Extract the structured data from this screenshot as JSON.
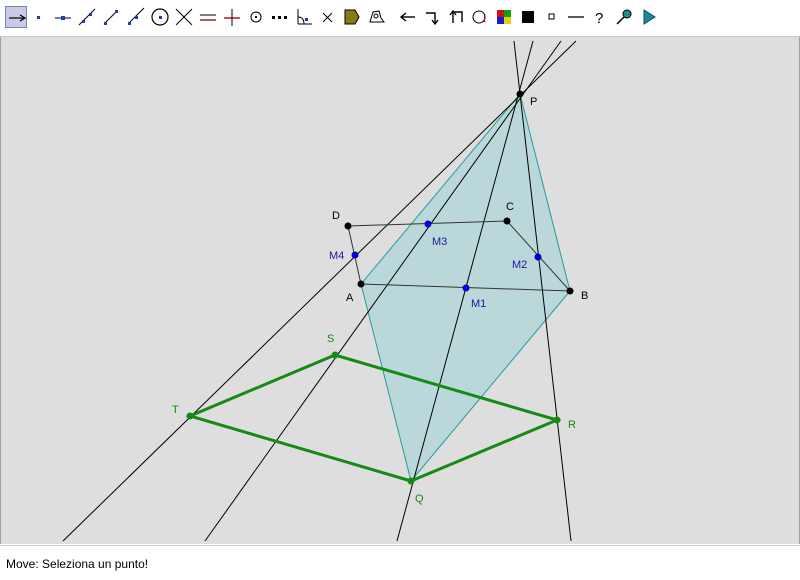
{
  "toolbar": {
    "tools": [
      {
        "name": "move-tool",
        "icon": "move-arrow-icon",
        "active": true
      },
      {
        "name": "point-tool",
        "icon": "point-icon"
      },
      {
        "name": "point-on-line-tool",
        "icon": "point-on-line-icon"
      },
      {
        "name": "line-tool",
        "icon": "line-icon"
      },
      {
        "name": "segment-tool",
        "icon": "segment-icon"
      },
      {
        "name": "ray-tool",
        "icon": "ray-icon"
      },
      {
        "name": "circle-tool",
        "icon": "circle-icon"
      },
      {
        "name": "intersection-tool",
        "icon": "intersection-icon"
      },
      {
        "name": "parallel-tool",
        "icon": "parallel-icon"
      },
      {
        "name": "perpendicular-tool",
        "icon": "perpendicular-icon"
      },
      {
        "name": "midpoint-tool",
        "icon": "midpoint-icon"
      },
      {
        "name": "dotted-line-tool",
        "icon": "dotted-line-icon"
      },
      {
        "name": "angle-tool",
        "icon": "angle-icon"
      },
      {
        "name": "delete-tool",
        "icon": "cross-icon"
      },
      {
        "name": "fill-tool",
        "icon": "fill-icon"
      },
      {
        "name": "measure-tool",
        "icon": "measure-icon"
      },
      {
        "name": "undo-tool",
        "icon": "left-arrow-icon"
      },
      {
        "name": "redo-tool",
        "icon": "redo-icon"
      },
      {
        "name": "back-tool",
        "icon": "back-icon"
      },
      {
        "name": "info-tool",
        "icon": "info-icon"
      },
      {
        "name": "color-tool",
        "icon": "color-palette-icon"
      },
      {
        "name": "black-square-tool",
        "icon": "black-square-icon"
      },
      {
        "name": "small-square-tool",
        "icon": "small-square-icon"
      },
      {
        "name": "dash-tool",
        "icon": "dash-icon"
      },
      {
        "name": "help-tool",
        "icon": "question-icon"
      },
      {
        "name": "hide-tool",
        "icon": "hide-icon"
      },
      {
        "name": "animation-tool",
        "icon": "play-icon"
      }
    ]
  },
  "colors": {
    "canvas": "#dedede",
    "black_point": "#000000",
    "midpoint": "#0000cc",
    "midpoint_label": "#1a1a99",
    "green": "#158a15",
    "fill": "#b0d6d8",
    "fill_stroke": "#2a9a9a"
  },
  "figure": {
    "points": [
      {
        "id": "P",
        "label": "P"
      },
      {
        "id": "A",
        "label": "A"
      },
      {
        "id": "B",
        "label": "B"
      },
      {
        "id": "C",
        "label": "C"
      },
      {
        "id": "D",
        "label": "D"
      },
      {
        "id": "M1",
        "label": "M1"
      },
      {
        "id": "M2",
        "label": "M2"
      },
      {
        "id": "M3",
        "label": "M3"
      },
      {
        "id": "M4",
        "label": "M4"
      },
      {
        "id": "Q",
        "label": "Q"
      },
      {
        "id": "R",
        "label": "R"
      },
      {
        "id": "S",
        "label": "S"
      },
      {
        "id": "T",
        "label": "T"
      }
    ]
  },
  "status": {
    "text": "Move: Seleziona un punto!"
  }
}
